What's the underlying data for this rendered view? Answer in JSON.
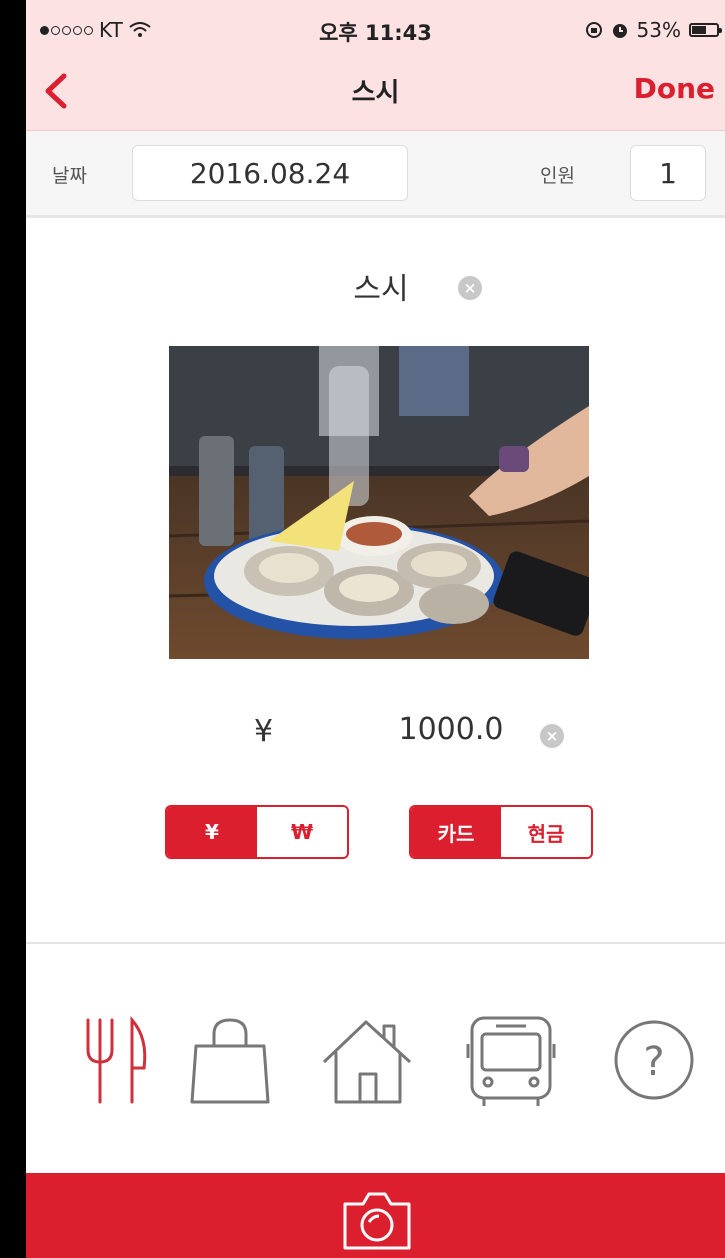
{
  "status_bar": {
    "carrier": "KT",
    "time": "오후 11:43",
    "battery": "53%"
  },
  "nav": {
    "title": "스시",
    "done_label": "Done",
    "back_icon": "chevron-left-icon"
  },
  "info": {
    "date_label": "날짜",
    "date_value": "2016.08.24",
    "people_label": "인원",
    "people_value": "1"
  },
  "entry": {
    "name": "스시",
    "currency_symbol": "¥",
    "price": "1000.0"
  },
  "currency_toggle": [
    {
      "label": "¥",
      "selected": true
    },
    {
      "label": "₩",
      "selected": false
    }
  ],
  "payment_toggle": [
    {
      "label": "카드",
      "selected": true
    },
    {
      "label": "현금",
      "selected": false
    }
  ],
  "categories": [
    "food-icon",
    "shopping-bag-icon",
    "home-icon",
    "bus-icon",
    "help-icon"
  ],
  "colors": {
    "accent": "#dc1f2e",
    "header_bg": "#fde2e4"
  }
}
